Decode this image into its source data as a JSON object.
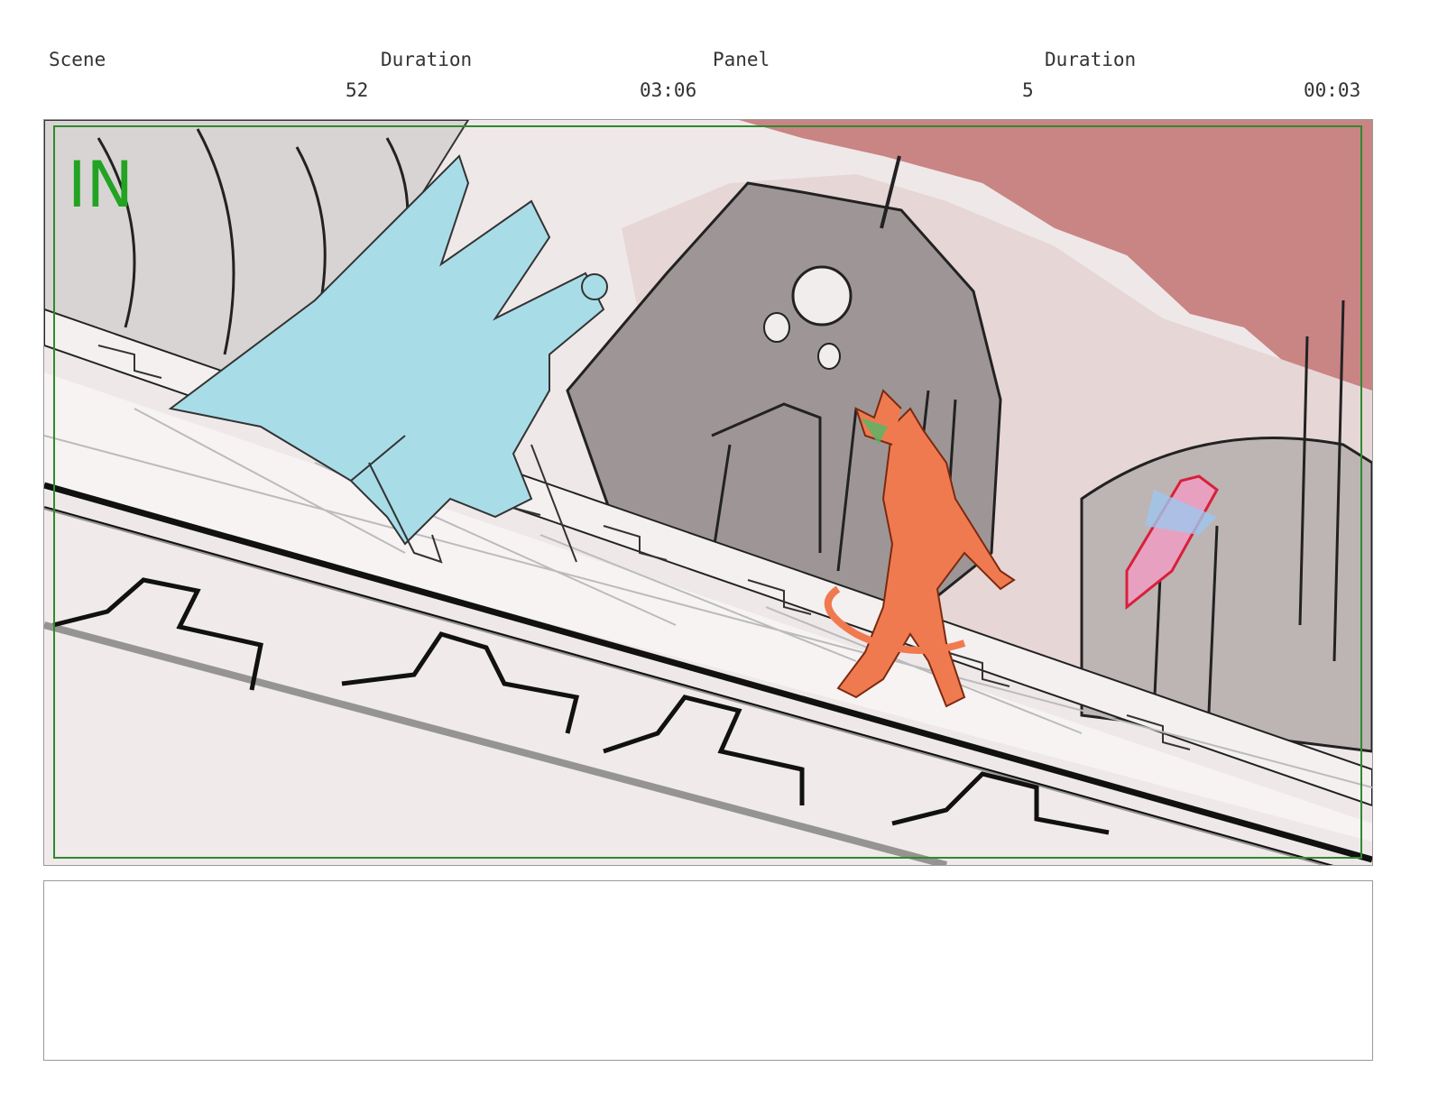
{
  "header": {
    "scene_label": "Scene",
    "scene_duration_label": "Duration",
    "panel_label": "Panel",
    "panel_duration_label": "Duration",
    "scene_value": "52",
    "scene_duration_value": "03:06",
    "panel_value": "5",
    "panel_duration_value": "00:03"
  },
  "panel": {
    "marker": "IN",
    "marker_color": "#22a322",
    "safe_frame_color": "#2f8a2f",
    "sky_color": "#c98484",
    "ghost_figure_color": "#a8dde8",
    "character_color": "#f07a4f"
  },
  "notes": {
    "text": ""
  }
}
